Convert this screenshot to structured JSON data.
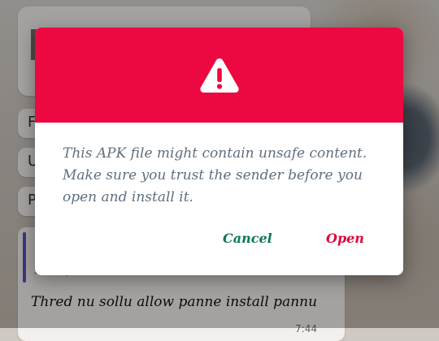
{
  "dialog": {
    "icon": "warning-triangle-icon",
    "message": "This APK file might contain unsafe content. Make sure you trust the sender before you open and install it.",
    "cancel_label": "Cancel",
    "open_label": "Open",
    "colors": {
      "header": "#ec0840",
      "cancel": "#0b7a52",
      "open": "#e0043d",
      "message": "#5f6f7e"
    }
  },
  "background_chat": {
    "options": [
      "F",
      "U",
      "P"
    ],
    "sender": "ssssleph",
    "message": "Thred nu sollu allow panne install pannu",
    "time": "7:44"
  }
}
